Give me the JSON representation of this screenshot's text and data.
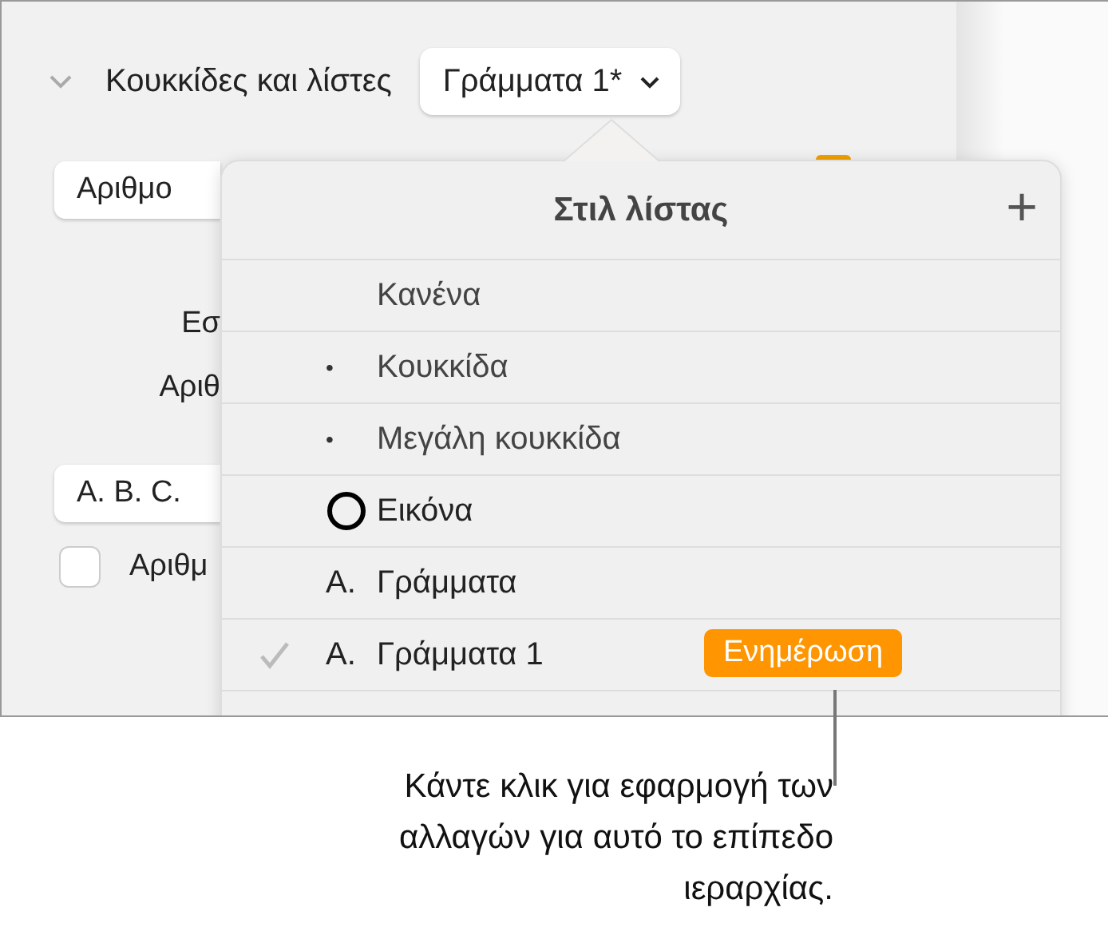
{
  "panel": {
    "section": {
      "title": "Κουκκίδες και λίστες",
      "expanded": true
    },
    "style_button": "Γράμματα 1*",
    "rows": [
      {
        "kind": "field",
        "text": "Αριθμο"
      },
      {
        "kind": "label",
        "text": "Εσ"
      },
      {
        "kind": "label",
        "text": "Αριθ"
      },
      {
        "kind": "field",
        "text": "A. B. C."
      },
      {
        "kind": "checkbox",
        "text": "Αριθμ",
        "checked": false
      }
    ]
  },
  "popover": {
    "title": "Στιλ λίστας",
    "add_button": "+",
    "items": [
      {
        "kind": "text",
        "label": "Κανένα",
        "selected": false
      },
      {
        "kind": "text",
        "marker": "•",
        "label": "Κουκκίδα",
        "selected": false
      },
      {
        "kind": "text",
        "marker": "•",
        "label": "Μεγάλη κουκκίδα",
        "selected": false
      },
      {
        "kind": "image",
        "label": "Εικόνα",
        "selected": false
      },
      {
        "kind": "text",
        "marker": "A.",
        "label": "Γράμματα",
        "selected": false
      },
      {
        "kind": "text",
        "marker": "A.",
        "label": "Γράμματα 1",
        "selected": true,
        "update_button": "Ενημέρωση"
      }
    ]
  },
  "callout": "Κάντε κλικ για εφαρμογή των αλλαγών για αυτό το επίπεδο ιεραρχίας."
}
